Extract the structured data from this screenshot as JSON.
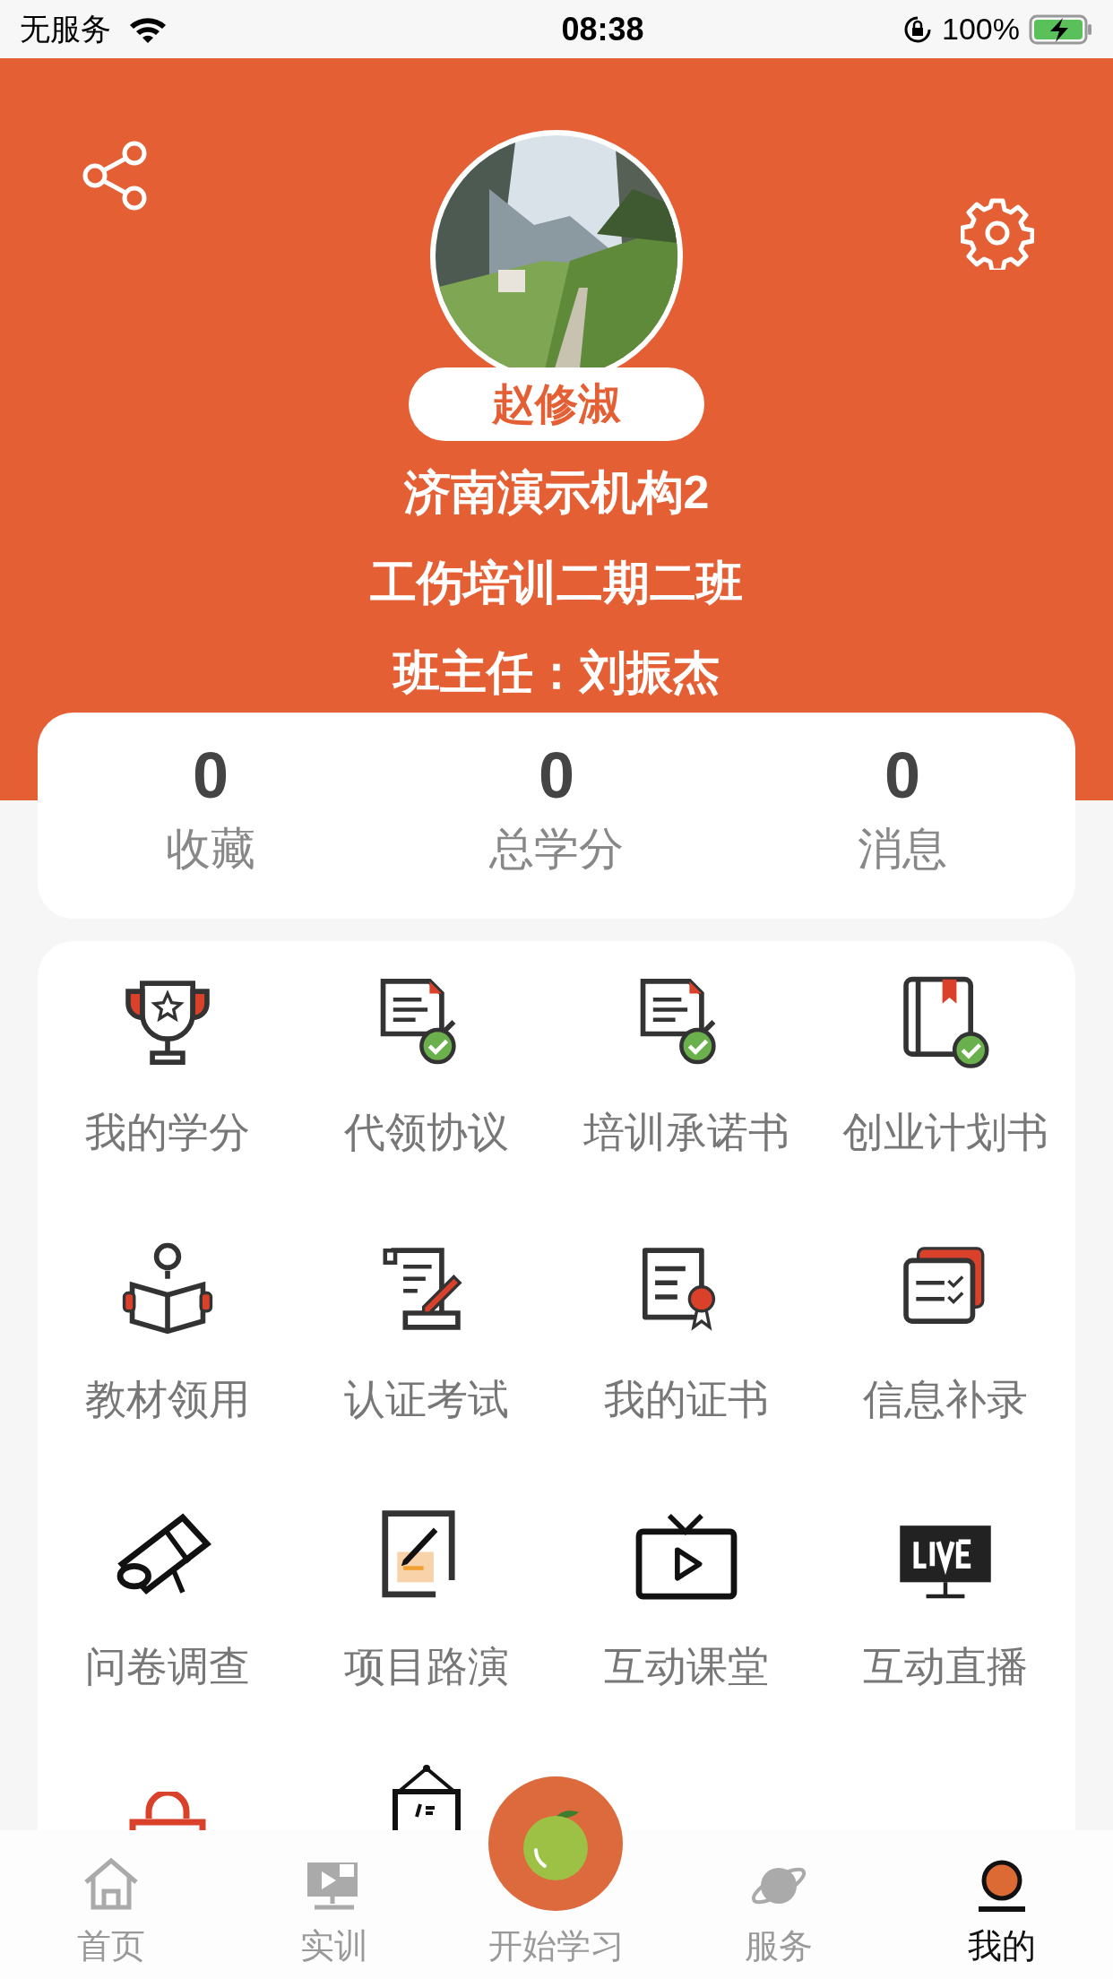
{
  "status_bar": {
    "carrier": "无服务",
    "time": "08:38",
    "battery": "100%"
  },
  "profile": {
    "name": "赵修淑",
    "organization": "济南演示机构2",
    "class": "工伤培训二期二班",
    "teacher": "班主任：刘振杰"
  },
  "stats": [
    {
      "value": "0",
      "label": "收藏"
    },
    {
      "value": "0",
      "label": "总学分"
    },
    {
      "value": "0",
      "label": "消息"
    }
  ],
  "menu": [
    {
      "label": "我的学分"
    },
    {
      "label": "代领协议"
    },
    {
      "label": "培训承诺书"
    },
    {
      "label": "创业计划书"
    },
    {
      "label": "教材领用"
    },
    {
      "label": "认证考试"
    },
    {
      "label": "我的证书"
    },
    {
      "label": "信息补录"
    },
    {
      "label": "问卷调查"
    },
    {
      "label": "项目路演"
    },
    {
      "label": "互动课堂"
    },
    {
      "label": "互动直播"
    }
  ],
  "tab_bar": [
    {
      "label": "首页",
      "selected": false
    },
    {
      "label": "实训",
      "selected": false
    },
    {
      "label": "开始学习",
      "selected": false
    },
    {
      "label": "服务",
      "selected": false
    },
    {
      "label": "我的",
      "selected": true
    }
  ]
}
